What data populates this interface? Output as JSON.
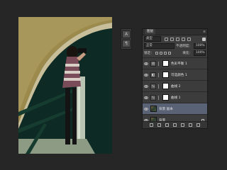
{
  "layers_panel": {
    "tab": "图层",
    "kind_filter": "类型",
    "blend_mode": "正常",
    "opacity_label": "不透明度：",
    "opacity_value": "100%",
    "lock_label": "锁定：",
    "fill_label": "填充：",
    "fill_value": "100%",
    "layers": [
      {
        "name": "色彩平衡 1",
        "icon": "balance-icon",
        "type": "adjustment",
        "visible": true,
        "active": false
      },
      {
        "name": "可选颜色 1",
        "icon": "selective-color-icon",
        "type": "adjustment",
        "visible": true,
        "active": false
      },
      {
        "name": "曲线 2",
        "icon": "curves-icon",
        "type": "adjustment",
        "visible": true,
        "active": false
      },
      {
        "name": "曲线 1",
        "icon": "curves-icon",
        "type": "adjustment",
        "visible": true,
        "active": false
      },
      {
        "name": "背景 副本",
        "type": "photo",
        "visible": true,
        "active": true
      },
      {
        "name": "背景",
        "type": "photo",
        "visible": true,
        "active": false,
        "locked": true
      }
    ]
  },
  "colors": {
    "app_background": "#262626",
    "panel": "#3c3c3c",
    "active_layer": "#5a6276"
  }
}
